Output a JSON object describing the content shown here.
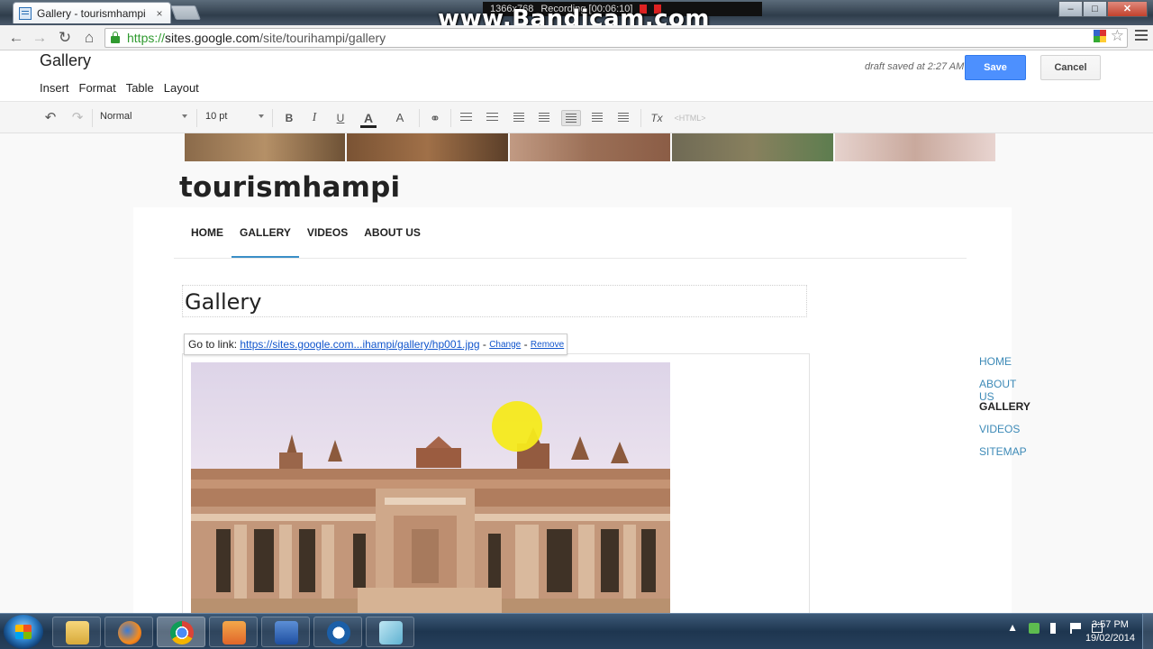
{
  "browser": {
    "tab_title": "Gallery - tourismhampi",
    "tab_close": "×",
    "url_scheme": "https://",
    "url_host": "sites.google.com",
    "url_path": "/site/tourihampi/gallery",
    "back": "←",
    "forward": "→",
    "reload": "↻",
    "home": "⌂",
    "star": "☆"
  },
  "recorder": {
    "watermark": "www.Bandicam.com",
    "resolution": "1366x768",
    "status": "Recording [00:06:10]"
  },
  "window_controls": {
    "minimize": "–",
    "maximize": "□",
    "close": "✕"
  },
  "editor": {
    "page_name": "Gallery",
    "menus": [
      "Insert",
      "Format",
      "Table",
      "Layout"
    ],
    "draft_status": "draft saved at 2:27 AM",
    "save_label": "Save",
    "cancel_label": "Cancel"
  },
  "format_toolbar": {
    "style_value": "Normal",
    "size_value": "10 pt",
    "bold": "B",
    "italic": "I",
    "underline": "U",
    "font_color": "A",
    "highlight": "A",
    "clear_format": "Tx",
    "html": "<HTML>",
    "undo": "↶",
    "redo": "↷",
    "link": "⚭"
  },
  "site": {
    "title": "tourismhampi",
    "nav": [
      "HOME",
      "GALLERY",
      "VIDEOS",
      "ABOUT US"
    ],
    "active_nav": "GALLERY",
    "page_title": "Gallery",
    "link_bubble": {
      "prefix": "Go to link:",
      "url": "https://sites.google.com...ihampi/gallery/hp001.jpg",
      "sep1": " - ",
      "change": "Change",
      "sep2": " - ",
      "remove": "Remove"
    },
    "sidebar": [
      "HOME",
      "ABOUT US",
      "GALLERY",
      "VIDEOS",
      "SITEMAP"
    ],
    "sidebar_active": "GALLERY"
  },
  "taskbar": {
    "time": "3:57 PM",
    "date": "19/02/2014",
    "tray_up": "▲"
  },
  "colors": {
    "save_blue": "#4d90fe",
    "link_blue": "#3d8ab7",
    "nav_underline": "#3b8fc7"
  }
}
